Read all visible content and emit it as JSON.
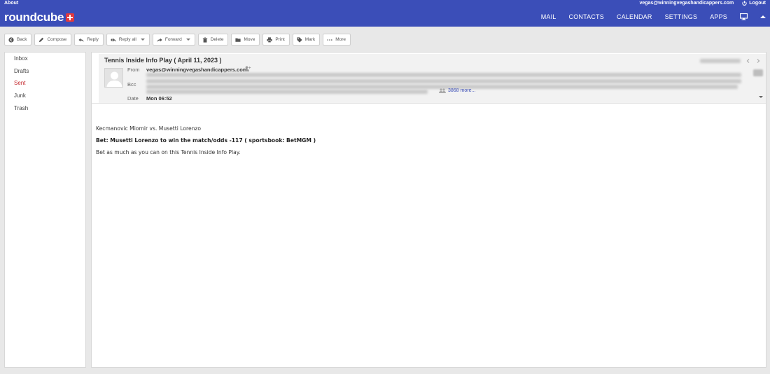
{
  "topbar": {
    "about": "About",
    "user_email": "vegas@winningvegashandicappers.com",
    "logout": "Logout",
    "logo": "roundcube",
    "nav": [
      "MAIL",
      "CONTACTS",
      "CALENDAR",
      "SETTINGS",
      "APPS"
    ],
    "color": "#3b4eb8"
  },
  "toolbar": {
    "back": "Back",
    "compose": "Compose",
    "reply": "Reply",
    "reply_all": "Reply all",
    "forward": "Forward",
    "delete": "Delete",
    "move": "Move",
    "print": "Print",
    "mark": "Mark",
    "more": "More"
  },
  "sidebar": {
    "folders": [
      {
        "label": "Inbox"
      },
      {
        "label": "Drafts"
      },
      {
        "label": "Sent",
        "active": true
      },
      {
        "label": "Junk"
      },
      {
        "label": "Trash"
      }
    ],
    "active_color": "#c3262b"
  },
  "message": {
    "subject": "Tennis Inside Info Play ( April 11, 2023 )",
    "from_label": "From",
    "from": "vegas@winningvegashandicappers.com",
    "bcc_label": "Bcc",
    "more_recipients": "3868 more...",
    "date_label": "Date",
    "date": "Mon 06:52",
    "body": [
      "Kecmanovic Miomir vs. Musetti Lorenzo",
      "Bet: Musetti Lorenzo to win the match/odds -117 ( sportsbook: BetMGM )",
      "Bet as much as you can on this Tennis Inside Info Play."
    ]
  }
}
